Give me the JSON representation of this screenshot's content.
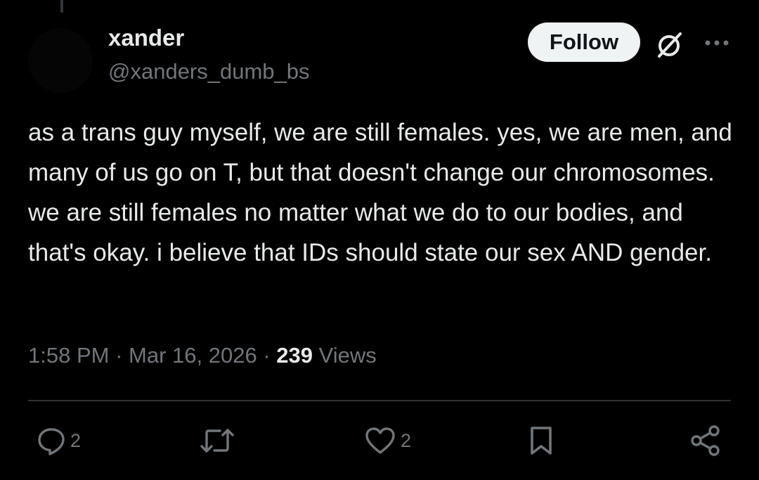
{
  "tweet": {
    "author": {
      "display_name": "xander",
      "handle": "@xanders_dumb_bs"
    },
    "follow_label": "Follow",
    "text": "as a trans guy myself, we are still females. yes, we are men, and many of us go on T, but that doesn't change our chromosomes. we are still females no matter what we do to our bodies, and that's okay. i believe that IDs should state our sex AND gender.",
    "time": "1:58 PM",
    "separator": "·",
    "date": "Mar 16, 2026",
    "views_count": "239",
    "views_label": "Views"
  },
  "actions": {
    "reply_count": "2",
    "like_count": "2"
  },
  "icons": {
    "reply": "reply-icon",
    "retweet": "retweet-icon",
    "like": "heart-icon",
    "bookmark": "bookmark-icon",
    "share": "share-icon",
    "grok": "grok-icon",
    "more": "more-icon"
  },
  "colors": {
    "background": "#000000",
    "primary_text": "#e7e9ea",
    "secondary_text": "#71767b",
    "follow_button_bg": "#eff3f4",
    "follow_button_text": "#0f1419",
    "divider": "#2f3336"
  }
}
